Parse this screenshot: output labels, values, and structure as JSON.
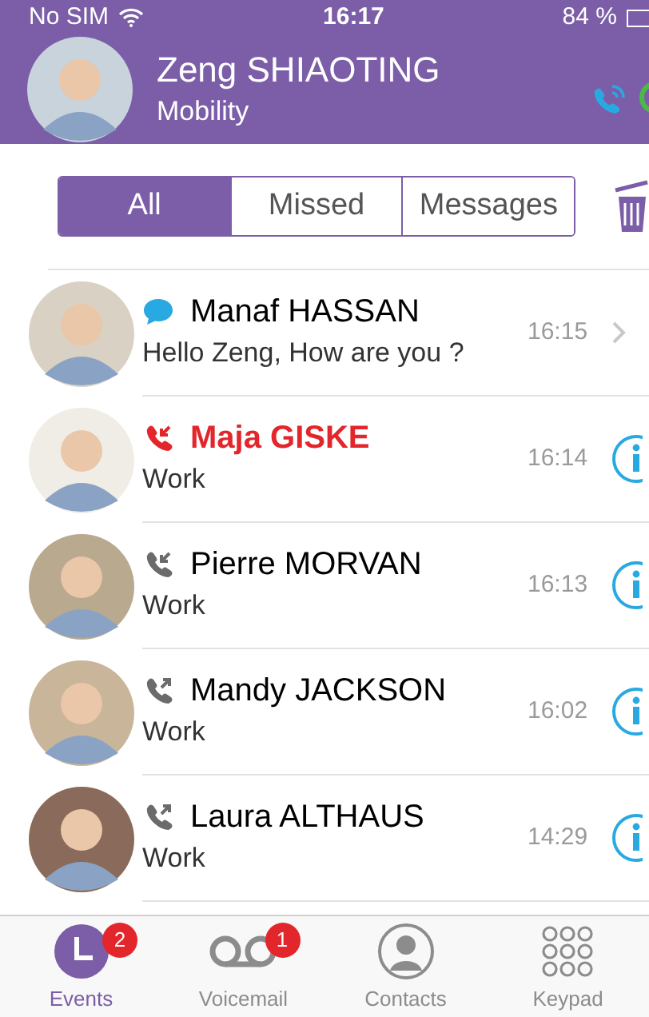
{
  "status_bar": {
    "carrier": "No SIM",
    "time": "16:17",
    "battery": "84 %"
  },
  "header": {
    "name": "Zeng SHIAOTING",
    "subtitle": "Mobility"
  },
  "filter_tabs": [
    {
      "label": "All",
      "selected": true
    },
    {
      "label": "Missed",
      "selected": false
    },
    {
      "label": "Messages",
      "selected": false
    }
  ],
  "events": [
    {
      "kind": "message",
      "name": "Manaf HASSAN",
      "detail": "Hello Zeng, How are you ?",
      "time": "16:15"
    },
    {
      "kind": "missed",
      "name": "Maja GISKE",
      "detail": "Work",
      "time": "16:14"
    },
    {
      "kind": "incoming",
      "name": "Pierre MORVAN",
      "detail": "Work",
      "time": "16:13"
    },
    {
      "kind": "outgoing",
      "name": "Mandy JACKSON",
      "detail": "Work",
      "time": "16:02"
    },
    {
      "kind": "outgoing",
      "name": "Laura ALTHAUS",
      "detail": "Work",
      "time": "14:29"
    }
  ],
  "tab_bar": [
    {
      "label": "Events",
      "badge": "2",
      "selected": true
    },
    {
      "label": "Voicemail",
      "badge": "1",
      "selected": false
    },
    {
      "label": "Contacts",
      "selected": false
    },
    {
      "label": "Keypad",
      "selected": false
    }
  ]
}
